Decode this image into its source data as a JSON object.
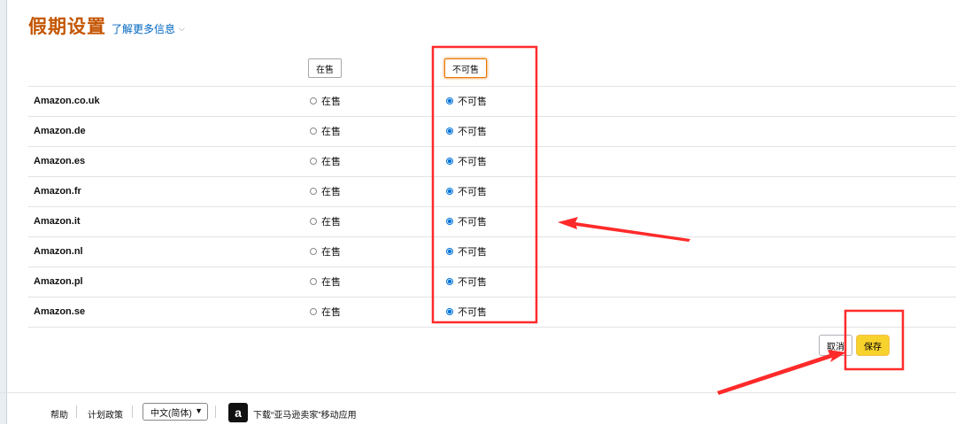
{
  "header": {
    "title": "假期设置",
    "more_info": "了解更多信息"
  },
  "columns": {
    "available": "在售",
    "unavailable": "不可售"
  },
  "rows": [
    {
      "site": "Amazon.co.uk",
      "available": "在售",
      "unavailable": "不可售",
      "selected": "unavailable"
    },
    {
      "site": "Amazon.de",
      "available": "在售",
      "unavailable": "不可售",
      "selected": "unavailable"
    },
    {
      "site": "Amazon.es",
      "available": "在售",
      "unavailable": "不可售",
      "selected": "unavailable"
    },
    {
      "site": "Amazon.fr",
      "available": "在售",
      "unavailable": "不可售",
      "selected": "unavailable"
    },
    {
      "site": "Amazon.it",
      "available": "在售",
      "unavailable": "不可售",
      "selected": "unavailable"
    },
    {
      "site": "Amazon.nl",
      "available": "在售",
      "unavailable": "不可售",
      "selected": "unavailable"
    },
    {
      "site": "Amazon.pl",
      "available": "在售",
      "unavailable": "不可售",
      "selected": "unavailable"
    },
    {
      "site": "Amazon.se",
      "available": "在售",
      "unavailable": "不可售",
      "selected": "unavailable"
    }
  ],
  "actions": {
    "cancel": "取消",
    "save": "保存"
  },
  "footer": {
    "help": "帮助",
    "policy": "计划政策",
    "language": "中文(简体)",
    "app_icon_letter": "a",
    "app_download": "下载“亚马逊卖家”移动应用"
  },
  "annotation_color": "#ff2a2a"
}
